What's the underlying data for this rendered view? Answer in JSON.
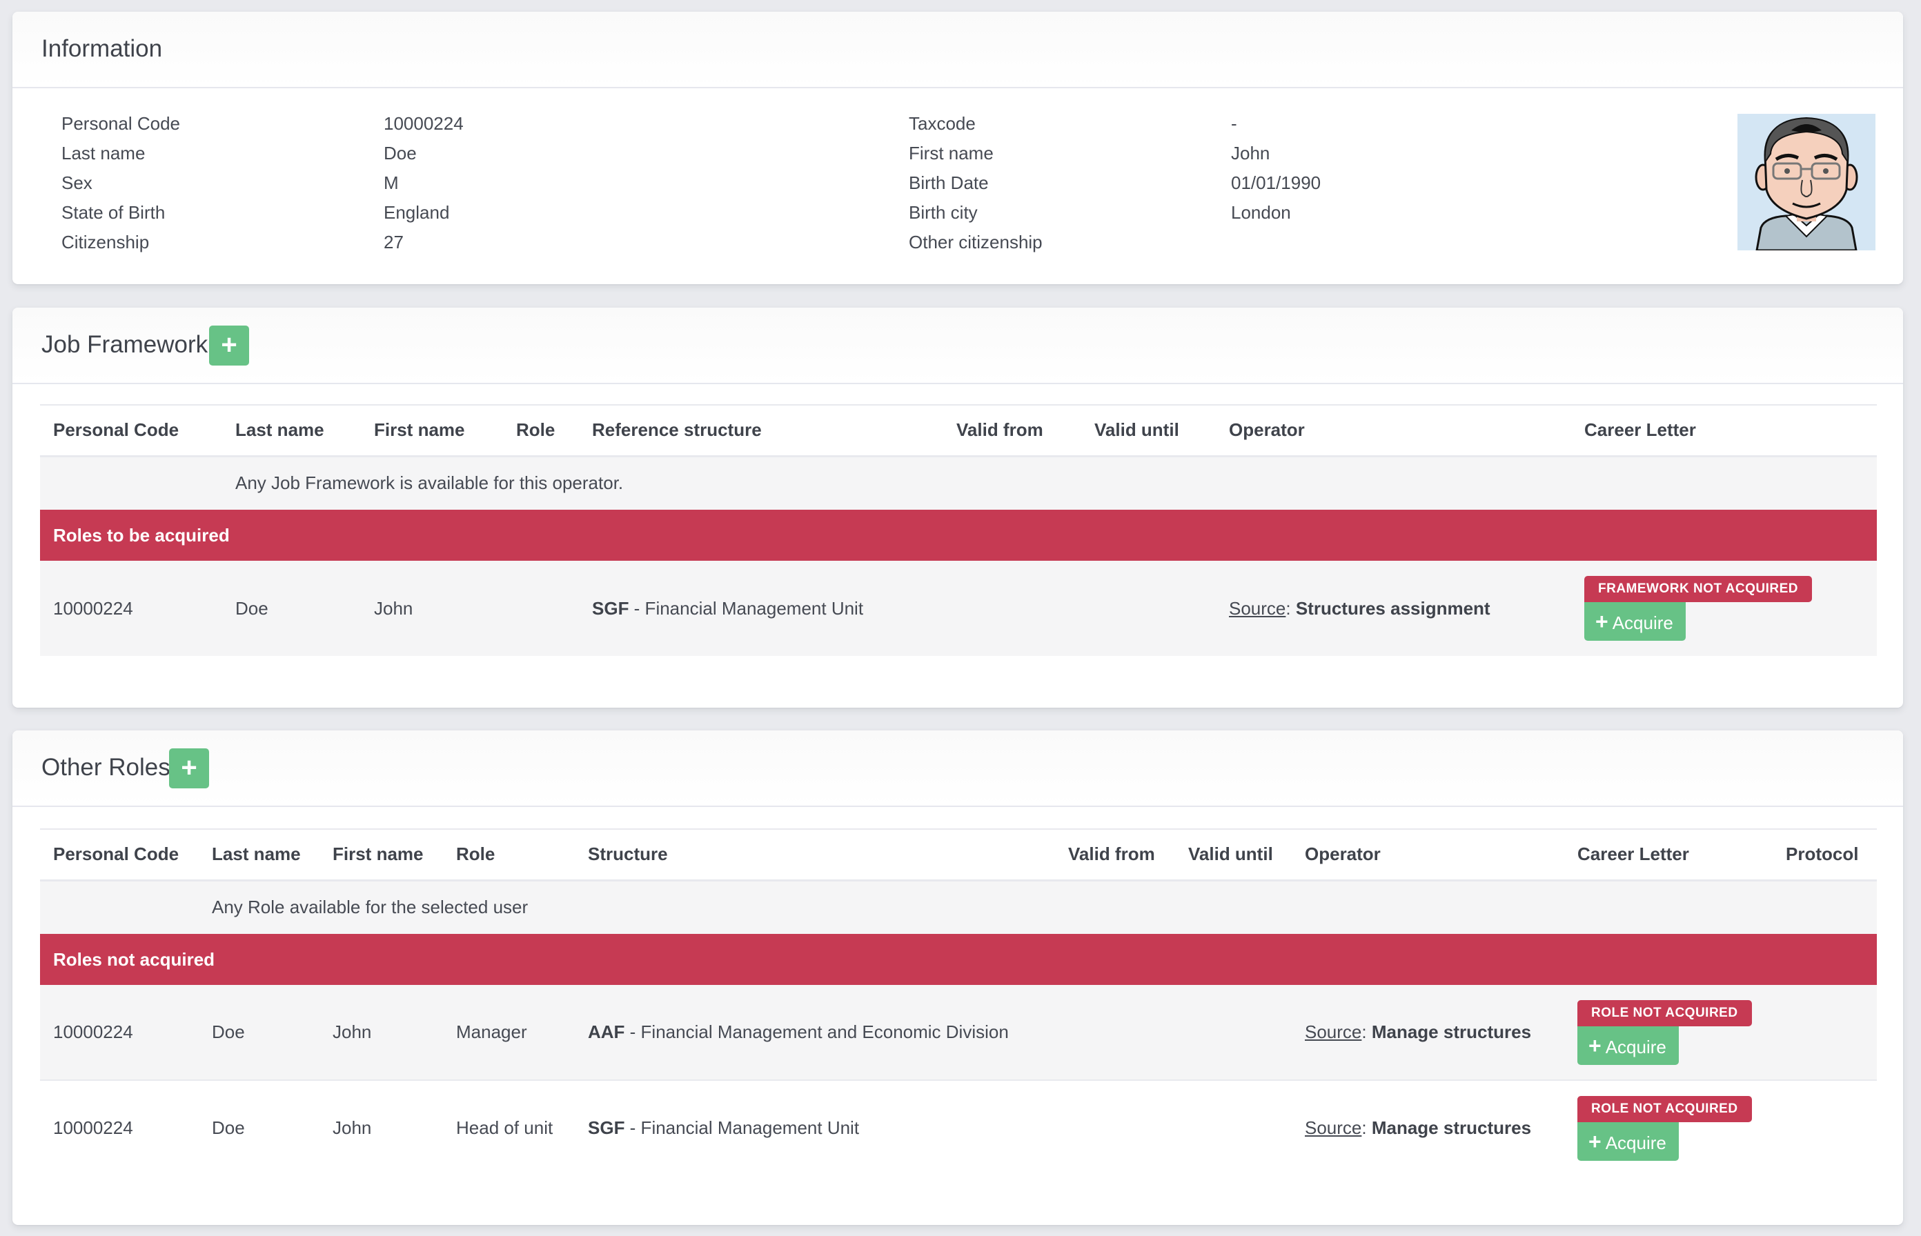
{
  "information": {
    "title": "Information",
    "left_fields": [
      {
        "label": "Personal Code",
        "value": "10000224"
      },
      {
        "label": "Last name",
        "value": "Doe"
      },
      {
        "label": "Sex",
        "value": "M"
      },
      {
        "label": "State of Birth",
        "value": "England"
      },
      {
        "label": "Citizenship",
        "value": "27"
      }
    ],
    "right_fields": [
      {
        "label": "Taxcode",
        "value": "-"
      },
      {
        "label": "First name",
        "value": "John"
      },
      {
        "label": "Birth Date",
        "value": "01/01/1990"
      },
      {
        "label": "Birth city",
        "value": "London"
      },
      {
        "label": "Other citizenship",
        "value": ""
      }
    ],
    "avatar_icon": "user-avatar-cartoon"
  },
  "job_framework": {
    "title": "Job Framework",
    "add_icon": "+",
    "columns": [
      "Personal Code",
      "Last name",
      "First name",
      "Role",
      "Reference structure",
      "Valid from",
      "Valid until",
      "Operator",
      "Career Letter"
    ],
    "empty_message": "Any Job Framework is available for this operator.",
    "group_label": "Roles to be acquired",
    "rows": [
      {
        "personal_code": "10000224",
        "last_name": "Doe",
        "first_name": "John",
        "role": "",
        "structure_code": "SGF",
        "structure_name": " - Financial Management Unit",
        "valid_from": "",
        "valid_until": "",
        "operator_source_label": "Source",
        "operator_source_value": "Structures assignment",
        "status_badge": "FRAMEWORK NOT ACQUIRED",
        "action_label": "Acquire",
        "action_icon": "+"
      }
    ]
  },
  "other_roles": {
    "title": "Other Roles",
    "add_icon": "+",
    "columns": [
      "Personal Code",
      "Last name",
      "First name",
      "Role",
      "Structure",
      "Valid from",
      "Valid until",
      "Operator",
      "Career Letter",
      "Protocol"
    ],
    "empty_message": "Any Role available for the selected user",
    "group_label": "Roles not acquired",
    "rows": [
      {
        "personal_code": "10000224",
        "last_name": "Doe",
        "first_name": "John",
        "role": "Manager",
        "structure_code": "AAF",
        "structure_name": " - Financial Management and Economic Division",
        "valid_from": "",
        "valid_until": "",
        "operator_source_label": "Source",
        "operator_source_value": "Manage structures",
        "status_badge": "ROLE NOT ACQUIRED",
        "action_label": "Acquire",
        "action_icon": "+",
        "protocol": ""
      },
      {
        "personal_code": "10000224",
        "last_name": "Doe",
        "first_name": "John",
        "role": "Head of unit",
        "structure_code": "SGF",
        "structure_name": " - Financial Management Unit",
        "valid_from": "",
        "valid_until": "",
        "operator_source_label": "Source",
        "operator_source_value": "Manage structures",
        "status_badge": "ROLE NOT ACQUIRED",
        "action_label": "Acquire",
        "action_icon": "+",
        "protocol": ""
      }
    ]
  },
  "colors": {
    "danger": "#c63a53",
    "success": "#67c286",
    "page_bg": "#e9eaee"
  }
}
